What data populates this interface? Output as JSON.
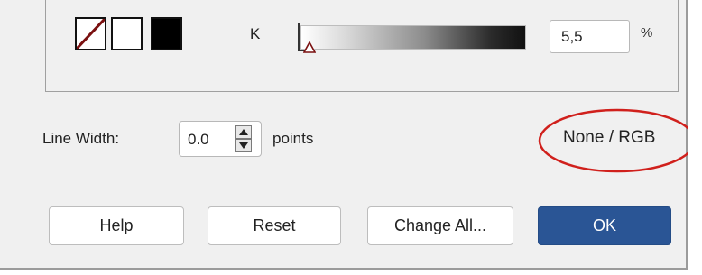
{
  "color_panel": {
    "swatches": [
      {
        "name": "none",
        "icon": "none-swatch-icon"
      },
      {
        "name": "white",
        "color": "#ffffff"
      },
      {
        "name": "black",
        "color": "#000000"
      }
    ],
    "channel_label": "K",
    "channel_value": "5,5",
    "channel_unit": "%"
  },
  "line_width": {
    "label": "Line Width:",
    "value": "0.0",
    "unit": "points"
  },
  "color_mode": "None / RGB",
  "buttons": {
    "help": "Help",
    "reset": "Reset",
    "change_all": "Change All...",
    "ok": "OK"
  },
  "colors": {
    "accent": "#2a5595",
    "highlight_ellipse": "#d0201c"
  }
}
